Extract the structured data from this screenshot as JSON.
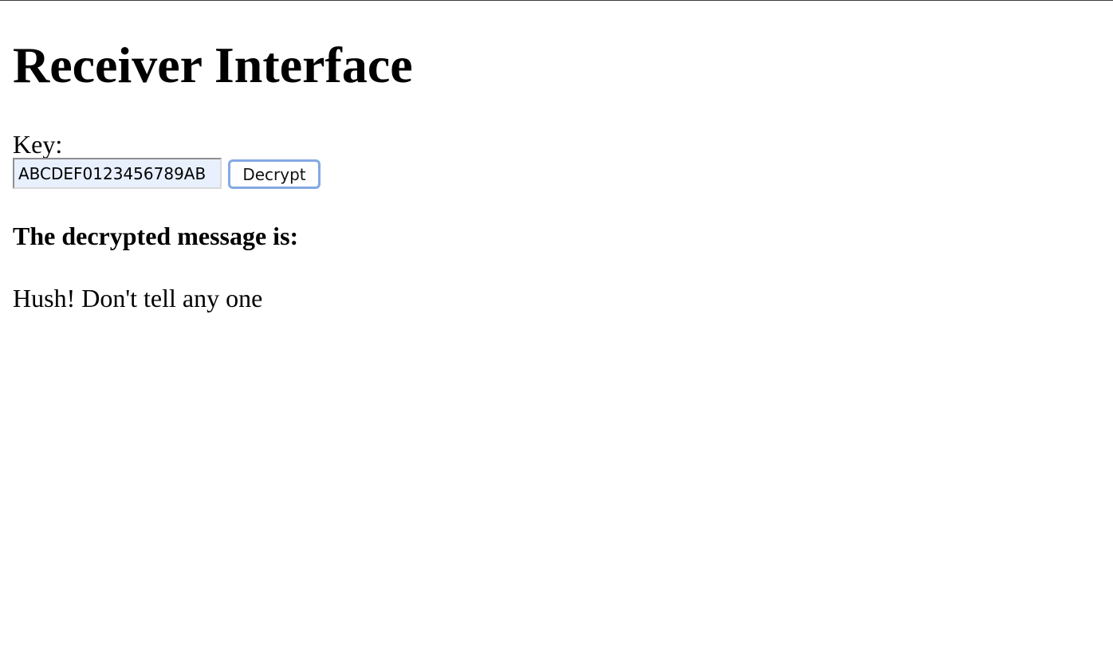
{
  "page": {
    "title": "Receiver Interface"
  },
  "form": {
    "key_label": "Key:",
    "key_value": "ABCDEF0123456789AB",
    "decrypt_label": "Decrypt"
  },
  "result": {
    "heading": "The decrypted message is:",
    "message": "Hush! Don't tell any one"
  },
  "colors": {
    "input_autofill_background": "#e8f0fe",
    "button_focus_border": "#84a9e4"
  }
}
